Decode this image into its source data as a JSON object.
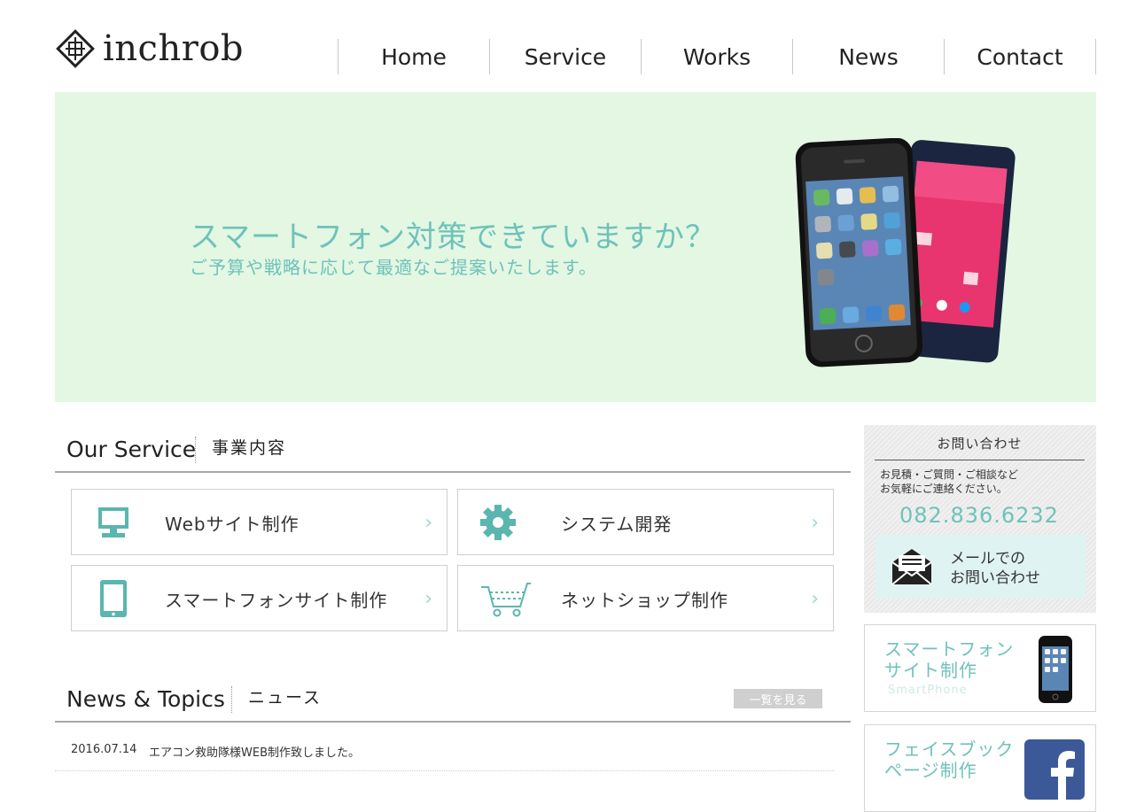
{
  "brand": {
    "name": "inchrob"
  },
  "nav": {
    "items": [
      "Home",
      "Service",
      "Works",
      "News",
      "Contact"
    ]
  },
  "hero": {
    "title": "スマートフォン対策できていますか？",
    "subtitle": "ご予算や戦略に応じて最適なご提案いたします。"
  },
  "service": {
    "heading_en": "Our Service",
    "heading_jp": "事業内容",
    "items": [
      {
        "label": "Webサイト制作",
        "icon": "monitor-icon"
      },
      {
        "label": "システム開発",
        "icon": "gear-icon"
      },
      {
        "label": "スマートフォンサイト制作",
        "icon": "tablet-icon"
      },
      {
        "label": "ネットショップ制作",
        "icon": "cart-icon"
      }
    ],
    "chevron": "›"
  },
  "news": {
    "heading_en": "News & Topics",
    "heading_jp": "ニュース",
    "more_label": "一覧を見る",
    "items": [
      {
        "date": "2016.07.14",
        "title": "エアコン救助隊様WEB制作致しました。"
      }
    ]
  },
  "contact": {
    "title": "お問い合わせ",
    "desc_line1": "お見積・ご質問・ご相談など",
    "desc_line2": "お気軽にご連絡ください。",
    "phone": "082.836.6232",
    "mail_line1": "メールでの",
    "mail_line2": "お問い合わせ"
  },
  "banners": [
    {
      "line1": "スマートフォン",
      "line2": "サイト制作",
      "sub": "SmartPhone"
    },
    {
      "line1": "フェイスブック",
      "line2": "ページ制作",
      "sub": ""
    }
  ],
  "colors": {
    "accent": "#6fc2ba",
    "hero_bg": "#e3f7e3",
    "facebook": "#3b5998"
  }
}
